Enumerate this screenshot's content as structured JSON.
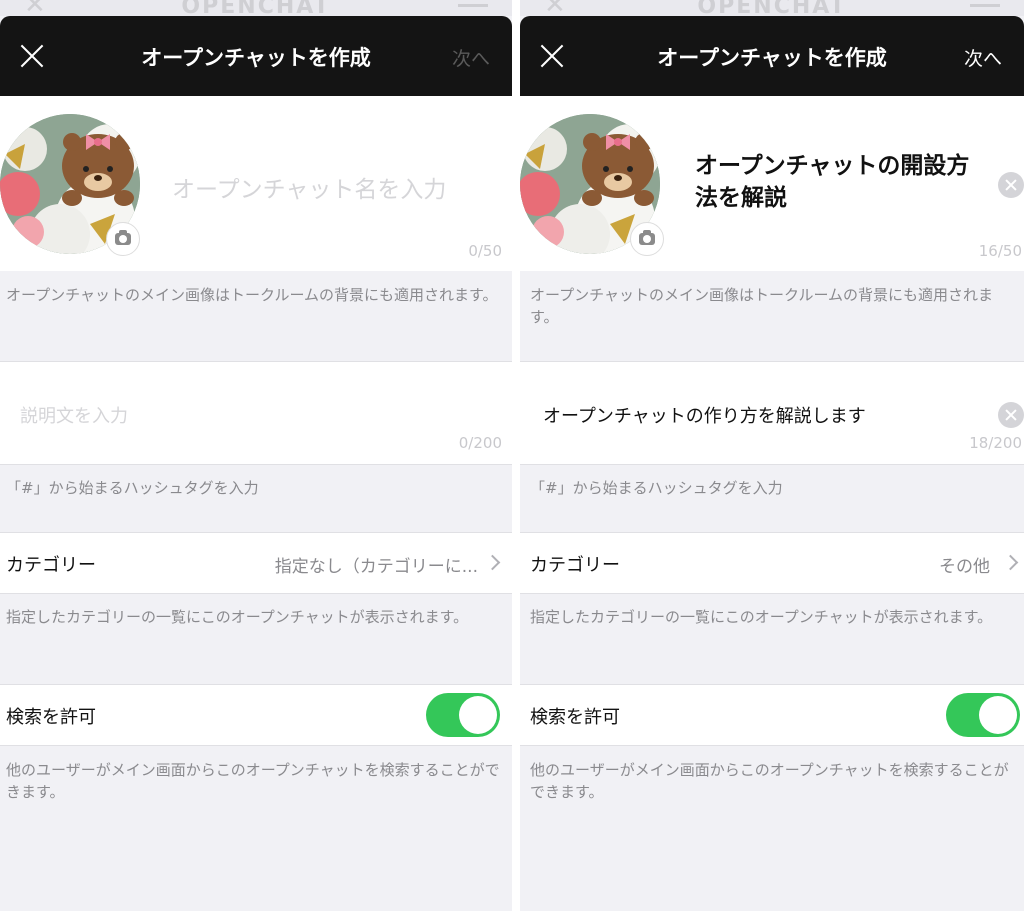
{
  "header": {
    "bg_title": "OPENCHAT",
    "title": "オープンチャットを作成",
    "next_label": "次へ"
  },
  "left": {
    "name_placeholder": "オープンチャット名を入力",
    "name_counter": "0/50",
    "image_note": "オープンチャットのメイン画像はトークルームの背景にも適用されます。",
    "desc_placeholder": "説明文を入力",
    "desc_counter": "0/200",
    "hashtag_note": "「#」から始まるハッシュタグを入力",
    "category_label": "カテゴリー",
    "category_value": "指定なし（カテゴリーに...",
    "category_note": "指定したカテゴリーの一覧にこのオープンチャットが表示されます。",
    "search_label": "検索を許可",
    "search_enabled": true,
    "search_note": "他のユーザーがメイン画面からこのオープンチャットを検索することができます。"
  },
  "right": {
    "name_value": "オープンチャットの開設方法を解説",
    "name_counter": "16/50",
    "image_note": "オープンチャットのメイン画像はトークルームの背景にも適用されます。",
    "desc_value": "オープンチャットの作り方を解説します",
    "desc_counter": "18/200",
    "hashtag_note": "「#」から始まるハッシュタグを入力",
    "category_label": "カテゴリー",
    "category_value": "その他",
    "category_note": "指定したカテゴリーの一覧にこのオープンチャットが表示されます。",
    "search_label": "検索を許可",
    "search_enabled": true,
    "search_note": "他のユーザーがメイン画面からこのオープンチャットを検索することができます。"
  },
  "icons": {
    "close": "close-icon",
    "camera": "camera-icon",
    "clear": "clear-icon",
    "chevron": "chevron-right-icon"
  },
  "colors": {
    "nav_bg": "#141414",
    "toggle_on": "#34c759",
    "page_bg": "#f1f1f5"
  }
}
